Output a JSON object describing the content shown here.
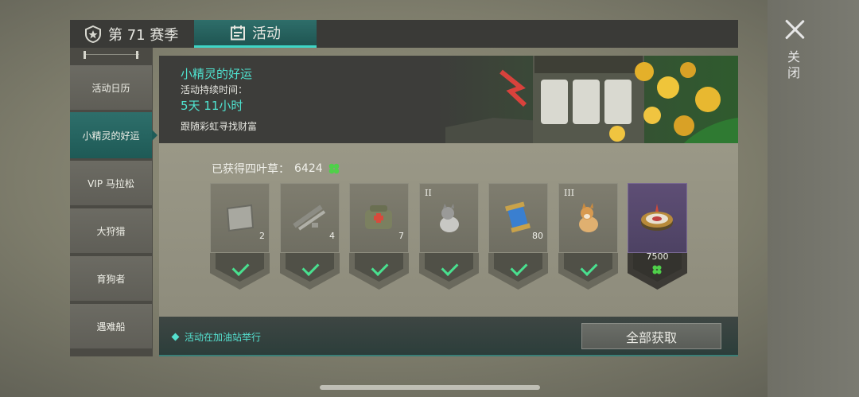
{
  "close": {
    "label": "关闭",
    "icon": "close-icon"
  },
  "tabs": [
    {
      "label": "第 71 赛季",
      "icon": "shield-star-icon",
      "active": false
    },
    {
      "label": "活动",
      "icon": "calendar-icon",
      "active": true
    }
  ],
  "sidebar": {
    "items": [
      {
        "label": "活动日历",
        "active": false
      },
      {
        "label": "小精灵的好运",
        "active": true
      },
      {
        "label": "VIP 马拉松",
        "active": false
      },
      {
        "label": "大狩猎",
        "active": false
      },
      {
        "label": "育狗者",
        "active": false
      },
      {
        "label": "遇难船",
        "active": false
      }
    ]
  },
  "event": {
    "title": "小精灵的好运",
    "duration_label": "活动持续时间：",
    "duration_value": "5天 11小时",
    "description": "跟随彩虹寻找财富"
  },
  "progress": {
    "label": "已获得四叶草：",
    "value": "6424",
    "icon": "clover-icon"
  },
  "rewards": [
    {
      "name": "metal-plate",
      "qty": "2",
      "roman": "",
      "claimed": true
    },
    {
      "name": "pipes",
      "qty": "4",
      "roman": "",
      "claimed": true
    },
    {
      "name": "medic-bag",
      "qty": "7",
      "roman": "",
      "claimed": true
    },
    {
      "name": "husky-dog",
      "qty": "",
      "roman": "II",
      "claimed": true
    },
    {
      "name": "energy-canister",
      "qty": "80",
      "roman": "",
      "claimed": true
    },
    {
      "name": "corgi-dog",
      "qty": "",
      "roman": "III",
      "claimed": true
    },
    {
      "name": "roulette-wheel",
      "qty": "",
      "roman": "",
      "claimed": false,
      "cost": "7500"
    }
  ],
  "footer": {
    "note": "活动在加油站举行",
    "claim_all_label": "全部获取"
  },
  "colors": {
    "accent": "#4fe3d0",
    "check": "#49e08f",
    "locked": "#5e4e75"
  }
}
